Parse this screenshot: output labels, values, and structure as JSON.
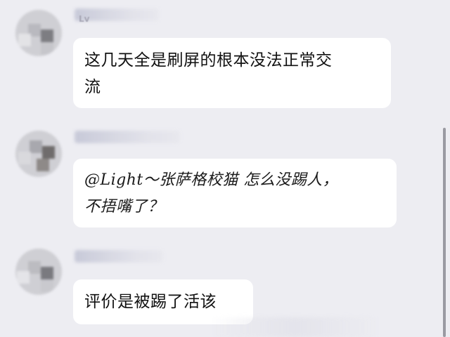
{
  "messages": [
    {
      "sender_tag": "Lv",
      "text": "这几天全是刷屏的根本没法正常交\n流"
    },
    {
      "sender_tag": "",
      "text": "@Light～张萨格校猫 怎么没踢人，\n不捂嘴了？"
    },
    {
      "sender_tag": "",
      "text": "评价是被踢了活该"
    }
  ],
  "colors": {
    "background": "#ededf2",
    "bubble": "#ffffff",
    "text": "#111111",
    "scrollbar": "#9a9aa2"
  }
}
